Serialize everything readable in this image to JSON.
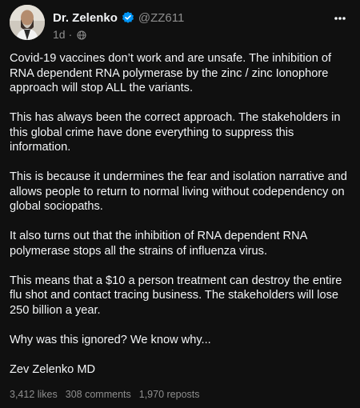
{
  "post": {
    "author": {
      "display_name": "Dr. Zelenko",
      "handle": "@ZZ611",
      "verified": true,
      "avatar_icon": "profile-photo"
    },
    "time_ago": "1d",
    "separator": "·",
    "visibility_icon": "globe-icon",
    "more_icon": "more-horizontal-icon",
    "paragraphs": [
      "Covid-19 vaccines don’t work and are unsafe. The inhibition of RNA dependent RNA polymerase by the zinc / zinc Ionophore approach will stop ALL the variants.",
      "This has always been the correct approach. The stakeholders in this global crime have done everything to suppress this information.",
      "This is because it undermines the fear and isolation narrative and allows people to return to normal living without codependency on global sociopaths.",
      "It also turns out that the inhibition of RNA dependent RNA polymerase stops all the strains of influenza virus.",
      "This means that a $10 a person treatment can destroy the entire flu shot and contact tracing business. The stakeholders will lose 250 billion a year.",
      "Why was this ignored? We know why...",
      "Zev Zelenko MD"
    ],
    "stats": {
      "likes": "3,412 likes",
      "comments": "308 comments",
      "reposts": "1,970 reposts"
    }
  },
  "colors": {
    "background": "#101010",
    "text": "#f3f5f7",
    "secondary": "#8e8e8e",
    "verified": "#0095f6"
  }
}
